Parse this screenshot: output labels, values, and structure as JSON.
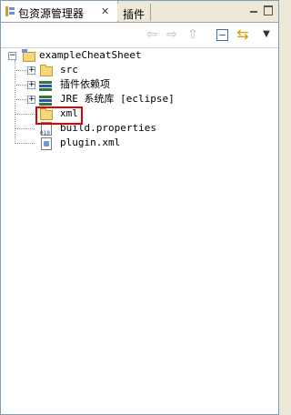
{
  "tabs": [
    {
      "label": "包资源管理器",
      "active": true
    },
    {
      "label": "插件",
      "active": false
    }
  ],
  "tree": {
    "project": "exampleCheatSheet",
    "items": [
      {
        "label": "src",
        "icon": "source-folder-icon"
      },
      {
        "label": "插件依赖项",
        "icon": "library-icon"
      },
      {
        "label": "JRE 系统库 [eclipse]",
        "icon": "library-icon"
      },
      {
        "label": "xml",
        "icon": "folder-icon",
        "highlighted": true
      },
      {
        "label": "build.properties",
        "icon": "properties-file-icon"
      },
      {
        "label": "plugin.xml",
        "icon": "plugin-file-icon"
      }
    ]
  },
  "colors": {
    "highlight_border": "#e00000",
    "frame_border": "#7f9db9"
  }
}
